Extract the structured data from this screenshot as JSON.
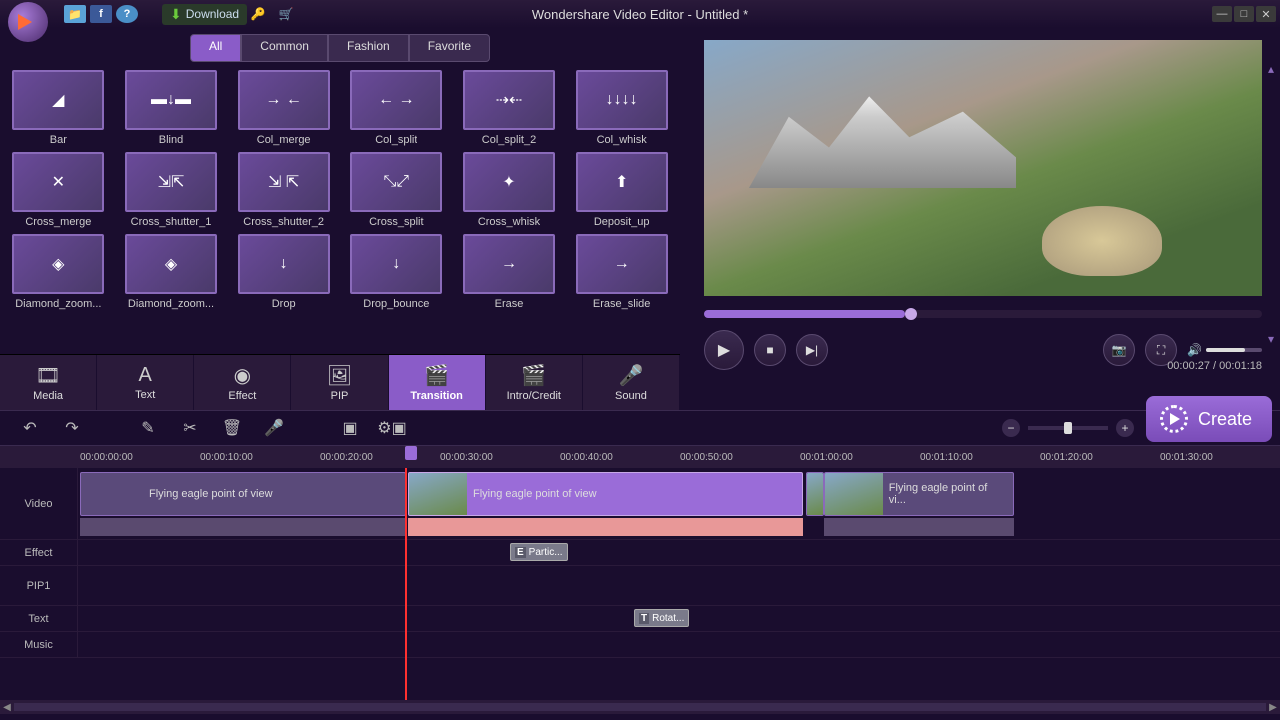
{
  "titlebar": {
    "title": "Wondershare Video Editor - Untitled *",
    "download": "Download"
  },
  "filterTabs": [
    "All",
    "Common",
    "Fashion",
    "Favorite"
  ],
  "filterActive": 0,
  "transitions": [
    "Bar",
    "Blind",
    "Col_merge",
    "Col_split",
    "Col_split_2",
    "Col_whisk",
    "Cross_merge",
    "Cross_shutter_1",
    "Cross_shutter_2",
    "Cross_split",
    "Cross_whisk",
    "Deposit_up",
    "Diamond_zoom...",
    "Diamond_zoom...",
    "Drop",
    "Drop_bounce",
    "Erase",
    "Erase_slide"
  ],
  "transIcons": [
    "◢",
    "▬↓▬",
    "→ ←",
    "← →",
    "⇢⇠",
    "↓↓↓↓",
    "✕",
    "⇲⇱",
    "⇲ ⇱",
    "⤡⤢",
    "✦",
    "⬆",
    "◈",
    "◈",
    "↓",
    "↓",
    "→",
    "→"
  ],
  "assetTabs": [
    {
      "label": "Media",
      "icon": "🎞"
    },
    {
      "label": "Text",
      "icon": "A"
    },
    {
      "label": "Effect",
      "icon": "◉"
    },
    {
      "label": "PIP",
      "icon": "🖼"
    },
    {
      "label": "Transition",
      "icon": "🎬"
    },
    {
      "label": "Intro/Credit",
      "icon": "🎬"
    },
    {
      "label": "Sound",
      "icon": "🎤"
    }
  ],
  "assetActive": 4,
  "player": {
    "time": "00:00:27 / 00:01:18"
  },
  "createBtn": "Create",
  "rulerMarks": [
    "00:00:00:00",
    "00:00:10:00",
    "00:00:20:00",
    "00:00:30:00",
    "00:00:40:00",
    "00:00:50:00",
    "00:01:00:00",
    "00:01:10:00",
    "00:01:20:00",
    "00:01:30:00"
  ],
  "tracks": {
    "video": "Video",
    "effect": "Effect",
    "pip": "PIP1",
    "text": "Text",
    "music": "Music"
  },
  "clips": {
    "c1": "Flying eagle point of view",
    "c2": "Flying eagle point of view",
    "c3": "Flying eagle point of vi...",
    "effect": "Partic...",
    "text": "Rotat..."
  },
  "effectBadge": "E",
  "textBadge": "T"
}
